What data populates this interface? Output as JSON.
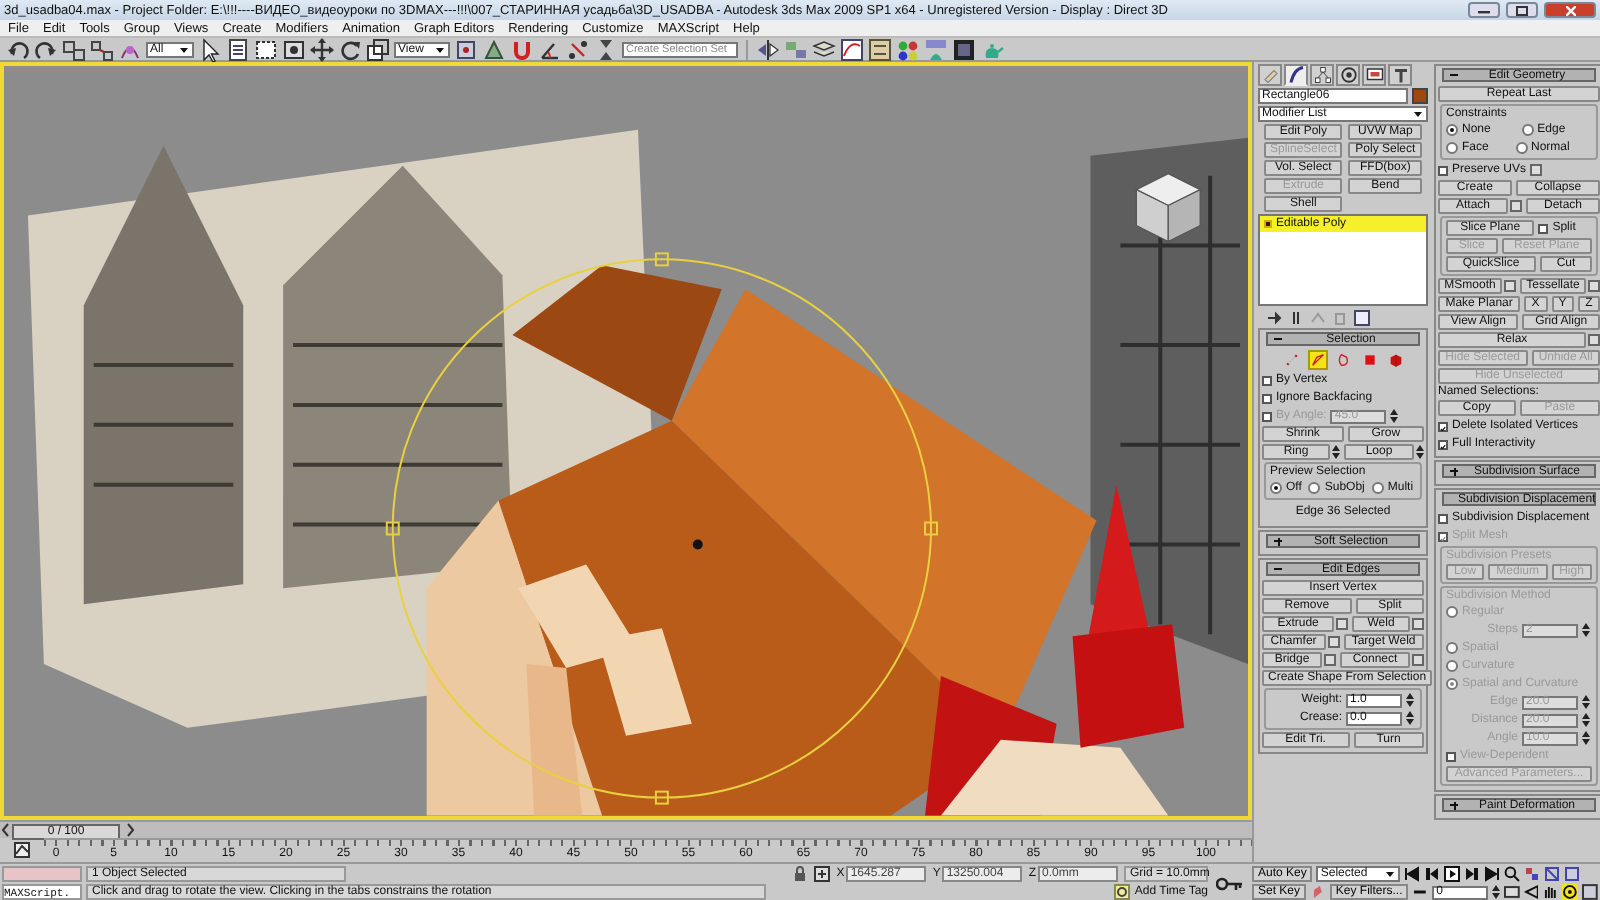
{
  "window": {
    "title": "3d_usadba04.max   - Project Folder: E:\\!!!----ВИДЕО_видеоуроки по 3DMAX---!!!\\007_СТАРИННАЯ усадьба\\3D_USADBA   - Autodesk 3ds Max  2009 SP1  x64   - Unregistered Version   - Display : Direct 3D"
  },
  "menu": [
    "File",
    "Edit",
    "Tools",
    "Group",
    "Views",
    "Create",
    "Modifiers",
    "Animation",
    "Graph Editors",
    "Rendering",
    "Customize",
    "MAXScript",
    "Help"
  ],
  "toolbar": {
    "selection_filter": "All",
    "reference_coordinate": "View",
    "named_selection": {
      "placeholder": "Create Selection Set"
    }
  },
  "viewport": {
    "active": true
  },
  "command_panel": {
    "tabs": [
      {
        "selected": false
      },
      {
        "selected": true
      },
      {
        "selected": false
      },
      {
        "selected": false
      },
      {
        "selected": false
      },
      {
        "selected": false
      }
    ],
    "object_name": "Rectangle06",
    "modifier_list": "Modifier List",
    "modifier_buttons": [
      {
        "label": "Edit Poly",
        "disabled": false
      },
      {
        "label": "UVW Map",
        "disabled": false
      },
      {
        "label": "SplineSelect",
        "disabled": true
      },
      {
        "label": "Poly Select",
        "disabled": false
      },
      {
        "label": "Vol. Select",
        "disabled": false
      },
      {
        "label": "FFD(box)",
        "disabled": false
      },
      {
        "label": "Extrude",
        "disabled": true
      },
      {
        "label": "Bend",
        "disabled": false
      },
      {
        "label": "Shell",
        "disabled": false
      }
    ],
    "stack": [
      {
        "label": "Editable Poly",
        "selected": true
      }
    ],
    "left_rollouts": [
      {
        "title": "Selection",
        "expanded": true,
        "items": [
          {
            "kind": "icons",
            "items": [
              {
                "selected": false
              },
              {
                "selected": true
              },
              {
                "selected": false
              },
              {
                "selected": false
              },
              {
                "selected": false
              }
            ]
          },
          {
            "kind": "checkbox",
            "label": "By Vertex",
            "checked": false,
            "disabled": false
          },
          {
            "kind": "checkbox",
            "label": "Ignore Backfacing",
            "checked": false,
            "disabled": false
          },
          {
            "kind": "checkbox",
            "label": "By Angle:",
            "checked": false,
            "disabled": true,
            "value": "45.0"
          },
          {
            "kind": "row",
            "items": [
              {
                "kind": "button",
                "label": "Shrink",
                "disabled": false
              },
              {
                "kind": "button",
                "label": "Grow",
                "disabled": false
              }
            ]
          },
          {
            "kind": "row",
            "items": [
              {
                "kind": "button",
                "label": "Ring",
                "disabled": false,
                "arrows": true
              },
              {
                "kind": "button",
                "label": "Loop",
                "disabled": false,
                "arrows": true
              }
            ]
          },
          {
            "kind": "group",
            "title": "Preview Selection",
            "disabled": false,
            "items": [
              {
                "kind": "row",
                "items": [
                  {
                    "kind": "radio",
                    "label": "Off",
                    "selected": true,
                    "disabled": false
                  },
                  {
                    "kind": "radio",
                    "label": "SubObj",
                    "selected": false,
                    "disabled": false
                  },
                  {
                    "kind": "radio",
                    "label": "Multi",
                    "selected": false,
                    "disabled": false
                  }
                ]
              }
            ]
          },
          {
            "kind": "caption",
            "label": "Edge 36 Selected"
          }
        ]
      },
      {
        "title": "Soft Selection",
        "expanded": false
      },
      {
        "title": "Edit Edges",
        "expanded": true,
        "items": [
          {
            "kind": "button",
            "label": "Insert Vertex",
            "disabled": false
          },
          {
            "kind": "row",
            "items": [
              {
                "kind": "button",
                "label": "Remove",
                "disabled": false
              },
              {
                "kind": "button",
                "label": "Split",
                "disabled": false
              }
            ]
          },
          {
            "kind": "row",
            "items": [
              {
                "kind": "button",
                "label": "Extrude",
                "disabled": false,
                "settings": true
              },
              {
                "kind": "button",
                "label": "Weld",
                "disabled": false,
                "settings": true
              }
            ]
          },
          {
            "kind": "row",
            "items": [
              {
                "kind": "button",
                "label": "Chamfer",
                "disabled": false,
                "settings": true
              },
              {
                "kind": "button",
                "label": "Target Weld",
                "disabled": false,
                "settings": false
              }
            ]
          },
          {
            "kind": "row",
            "items": [
              {
                "kind": "button",
                "label": "Bridge",
                "disabled": false,
                "settings": true
              },
              {
                "kind": "button",
                "label": "Connect",
                "disabled": false,
                "settings": true
              }
            ]
          },
          {
            "kind": "button",
            "label": "Create Shape From Selection",
            "disabled": false
          },
          {
            "kind": "group",
            "disabled": false,
            "items": [
              {
                "kind": "spinner",
                "label": "Weight:",
                "value": "1.0",
                "disabled": false
              },
              {
                "kind": "spinner",
                "label": "Crease:",
                "value": "0.0",
                "disabled": false
              }
            ]
          },
          {
            "kind": "row",
            "items": [
              {
                "kind": "button",
                "label": "Edit Tri.",
                "disabled": false
              },
              {
                "kind": "button",
                "label": "Turn",
                "disabled": false
              }
            ]
          }
        ]
      }
    ],
    "right_rollouts": [
      {
        "title": "Edit Geometry",
        "expanded": true,
        "items": [
          {
            "kind": "button",
            "label": "Repeat Last",
            "disabled": false
          },
          {
            "kind": "group",
            "title": "Constraints",
            "disabled": false,
            "items": [
              {
                "kind": "row",
                "items": [
                  {
                    "kind": "radio",
                    "label": "None",
                    "selected": true,
                    "disabled": false
                  },
                  {
                    "kind": "radio",
                    "label": "Edge",
                    "selected": false,
                    "disabled": false
                  }
                ]
              },
              {
                "kind": "row",
                "items": [
                  {
                    "kind": "radio",
                    "label": "Face",
                    "selected": false,
                    "disabled": false
                  },
                  {
                    "kind": "radio",
                    "label": "Normal",
                    "selected": false,
                    "disabled": false
                  }
                ]
              }
            ]
          },
          {
            "kind": "checkbox",
            "label": "Preserve UVs",
            "checked": false,
            "disabled": false,
            "settings": true
          },
          {
            "kind": "row",
            "items": [
              {
                "kind": "button",
                "label": "Create",
                "disabled": false
              },
              {
                "kind": "button",
                "label": "Collapse",
                "disabled": false
              }
            ]
          },
          {
            "kind": "row",
            "items": [
              {
                "kind": "button",
                "label": "Attach",
                "disabled": false,
                "settings": true
              },
              {
                "kind": "button",
                "label": "Detach",
                "disabled": false,
                "settings": false
              }
            ]
          },
          {
            "kind": "group",
            "disabled": false,
            "items": [
              {
                "kind": "row",
                "items": [
                  {
                    "kind": "button",
                    "label": "Slice Plane",
                    "disabled": false
                  },
                  {
                    "kind": "checkbox",
                    "label": "Split",
                    "checked": false,
                    "disabled": false
                  }
                ]
              },
              {
                "kind": "row",
                "items": [
                  {
                    "kind": "button",
                    "label": "Slice",
                    "disabled": true
                  },
                  {
                    "kind": "button",
                    "label": "Reset Plane",
                    "disabled": true
                  }
                ]
              },
              {
                "kind": "row",
                "items": [
                  {
                    "kind": "button",
                    "label": "QuickSlice",
                    "disabled": false
                  },
                  {
                    "kind": "button",
                    "label": "Cut",
                    "disabled": false
                  }
                ]
              }
            ]
          },
          {
            "kind": "row",
            "items": [
              {
                "kind": "button",
                "label": "MSmooth",
                "disabled": false,
                "settings": true
              },
              {
                "kind": "button",
                "label": "Tessellate",
                "disabled": false,
                "settings": true
              }
            ]
          },
          {
            "kind": "row",
            "items": [
              {
                "kind": "button",
                "label": "Make Planar",
                "disabled": false
              },
              {
                "kind": "button",
                "label": "X",
                "disabled": false
              },
              {
                "kind": "button",
                "label": "Y",
                "disabled": false
              },
              {
                "kind": "button",
                "label": "Z",
                "disabled": false
              }
            ]
          },
          {
            "kind": "row",
            "items": [
              {
                "kind": "button",
                "label": "View Align",
                "disabled": false
              },
              {
                "kind": "button",
                "label": "Grid Align",
                "disabled": false
              }
            ]
          },
          {
            "kind": "button",
            "label": "Relax",
            "disabled": false,
            "settings": true
          },
          {
            "kind": "row",
            "items": [
              {
                "kind": "button",
                "label": "Hide Selected",
                "disabled": true
              },
              {
                "kind": "button",
                "label": "Unhide All",
                "disabled": true
              }
            ]
          },
          {
            "kind": "button",
            "label": "Hide Unselected",
            "disabled": true
          },
          {
            "kind": "label",
            "label": "Named Selections:"
          },
          {
            "kind": "row",
            "items": [
              {
                "kind": "button",
                "label": "Copy",
                "disabled": false
              },
              {
                "kind": "button",
                "label": "Paste",
                "disabled": true
              }
            ]
          },
          {
            "kind": "checkbox",
            "label": "Delete Isolated Vertices",
            "checked": true,
            "disabled": false
          },
          {
            "kind": "checkbox",
            "label": "Full Interactivity",
            "checked": true,
            "disabled": false
          }
        ]
      },
      {
        "title": "Subdivision Surface",
        "expanded": false
      },
      {
        "title": "Subdivision Displacement",
        "expanded": true,
        "items": [
          {
            "kind": "checkbox",
            "label": "Subdivision Displacement",
            "checked": false,
            "disabled": false
          },
          {
            "kind": "checkbox",
            "label": "Split Mesh",
            "checked": true,
            "disabled": true
          },
          {
            "kind": "group",
            "title": "Subdivision Presets",
            "disabled": true,
            "items": [
              {
                "kind": "row",
                "items": [
                  {
                    "kind": "button",
                    "label": "Low"
                  },
                  {
                    "kind": "button",
                    "label": "Medium"
                  },
                  {
                    "kind": "button",
                    "label": "High"
                  }
                ]
              }
            ]
          },
          {
            "kind": "group",
            "title": "Subdivision Method",
            "disabled": true,
            "items": [
              {
                "kind": "radio",
                "label": "Regular",
                "selected": false
              },
              {
                "kind": "spinner",
                "label": "Steps",
                "value": "2"
              },
              {
                "kind": "radio",
                "label": "Spatial",
                "selected": false
              },
              {
                "kind": "radio",
                "label": "Curvature",
                "selected": false
              },
              {
                "kind": "radio",
                "label": "Spatial and Curvature",
                "selected": true
              },
              {
                "kind": "spinner",
                "label": "Edge",
                "value": "20.0"
              },
              {
                "kind": "spinner",
                "label": "Distance",
                "value": "20.0"
              },
              {
                "kind": "spinner",
                "label": "Angle",
                "value": "10.0"
              },
              {
                "kind": "checkbox",
                "label": "View-Dependent",
                "checked": false
              },
              {
                "kind": "button",
                "label": "Advanced Parameters..."
              }
            ]
          }
        ]
      },
      {
        "title": "Paint Deformation",
        "expanded": false
      }
    ]
  },
  "time_slider": {
    "label": "0 / 100",
    "level": 0
  },
  "track_bar": {
    "ticks": [
      "0",
      "5",
      "10",
      "15",
      "20",
      "25",
      "30",
      "35",
      "40",
      "45",
      "50",
      "55",
      "60",
      "65",
      "70",
      "75",
      "80",
      "85",
      "90",
      "95",
      "100"
    ]
  },
  "status": {
    "listener": "MAXScript.",
    "selection": "1 Object Selected",
    "prompt": "Click and drag to rotate the view.  Clicking in the tabs constrains the rotation",
    "coordinates": [
      {
        "axis": "X",
        "value": "1645.287"
      },
      {
        "axis": "Y",
        "value": "13250.004"
      },
      {
        "axis": "Z",
        "value": "0.0mm"
      }
    ],
    "grid": "Grid = 10.0mm",
    "time_tag": "Add Time Tag",
    "auto_key": "Auto Key",
    "key_mode": "Selected",
    "set_key": "Set Key",
    "key_filters": "Key Filters...",
    "frame": "0"
  }
}
